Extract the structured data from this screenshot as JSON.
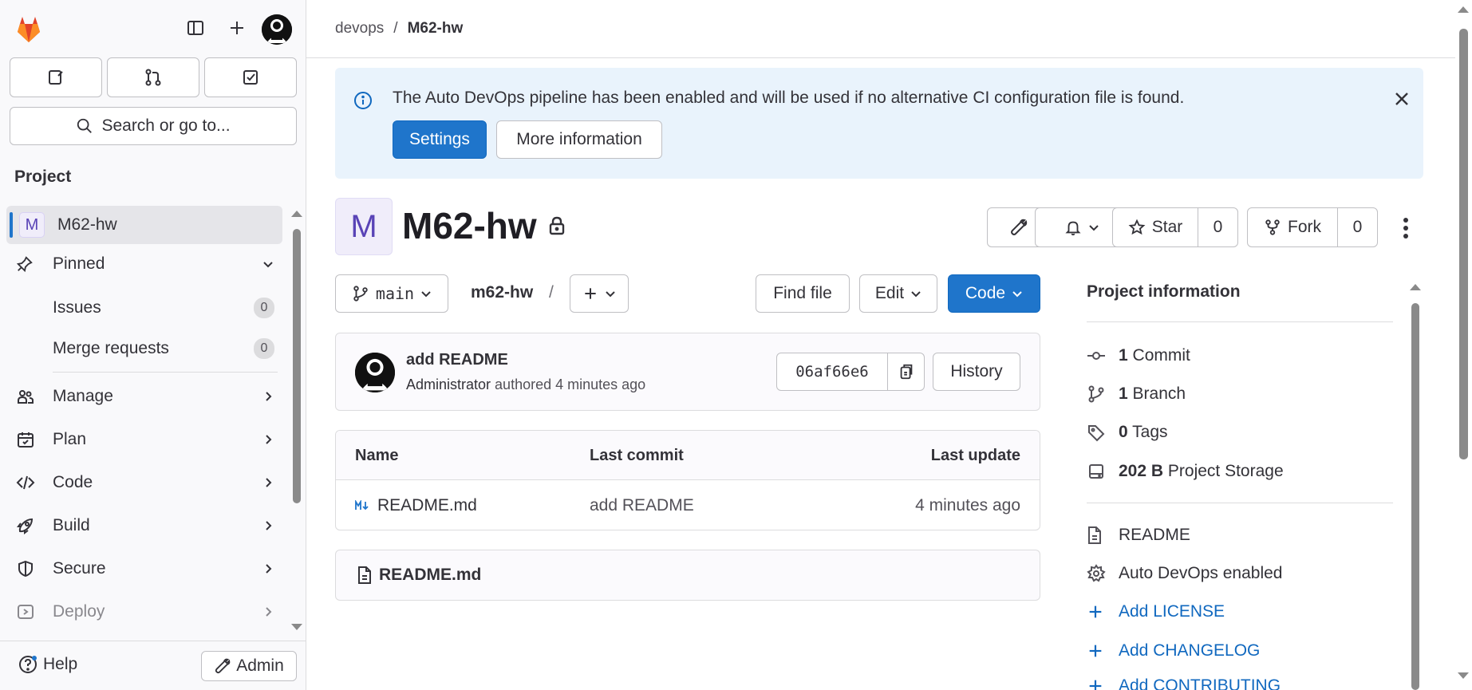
{
  "sidebar": {
    "search_placeholder": "Search or go to...",
    "section_title": "Project",
    "project_item": {
      "initial": "M",
      "label": "M62-hw"
    },
    "pinned": {
      "label": "Pinned",
      "items": [
        {
          "label": "Issues",
          "count": "0"
        },
        {
          "label": "Merge requests",
          "count": "0"
        }
      ]
    },
    "nav": [
      {
        "label": "Manage",
        "icon": "users-icon"
      },
      {
        "label": "Plan",
        "icon": "calendar-icon"
      },
      {
        "label": "Code",
        "icon": "code-icon"
      },
      {
        "label": "Build",
        "icon": "rocket-icon"
      },
      {
        "label": "Secure",
        "icon": "shield-icon"
      },
      {
        "label": "Deploy",
        "icon": "deploy-icon"
      }
    ],
    "help_label": "Help",
    "admin_label": "Admin"
  },
  "breadcrumb": {
    "group": "devops",
    "separator": "/",
    "current": "M62-hw"
  },
  "banner": {
    "message": "The Auto DevOps pipeline has been enabled and will be used if no alternative CI configuration file is found.",
    "settings_label": "Settings",
    "more_info_label": "More information"
  },
  "project": {
    "initial": "M",
    "name": "M62-hw",
    "star_label": "Star",
    "star_count": "0",
    "fork_label": "Fork",
    "fork_count": "0"
  },
  "repo": {
    "branch": "main",
    "path": "m62-hw",
    "path_separator": "/",
    "find_file_label": "Find file",
    "edit_label": "Edit",
    "code_label": "Code"
  },
  "commit": {
    "title": "add README",
    "author": "Administrator",
    "verb": "authored",
    "time": "4 minutes ago",
    "sha": "06af66e6",
    "history_label": "History"
  },
  "files": {
    "headers": {
      "name": "Name",
      "last_commit": "Last commit",
      "last_update": "Last update"
    },
    "rows": [
      {
        "name": "README.md",
        "last_commit": "add README",
        "last_update": "4 minutes ago"
      }
    ]
  },
  "readme": {
    "filename": "README.md"
  },
  "project_info": {
    "title": "Project information",
    "stats": [
      {
        "value": "1",
        "label": "Commit",
        "icon": "commit-icon"
      },
      {
        "value": "1",
        "label": "Branch",
        "icon": "branch-icon"
      },
      {
        "value": "0",
        "label": "Tags",
        "icon": "tag-icon"
      },
      {
        "value": "202 B",
        "label": "Project Storage",
        "icon": "storage-icon"
      }
    ],
    "links": [
      {
        "label": "README",
        "icon": "file-icon"
      },
      {
        "label": "Auto DevOps enabled",
        "icon": "settings-icon"
      },
      {
        "label": "Add LICENSE",
        "icon": "plus-icon"
      },
      {
        "label": "Add CHANGELOG",
        "icon": "plus-icon"
      },
      {
        "label": "Add CONTRIBUTING",
        "icon": "plus-icon"
      }
    ]
  },
  "colors": {
    "primary": "#1f75cb",
    "link": "#1068bf",
    "banner_bg": "#e9f3fc",
    "sidebar_bg": "#f9f9fb"
  }
}
